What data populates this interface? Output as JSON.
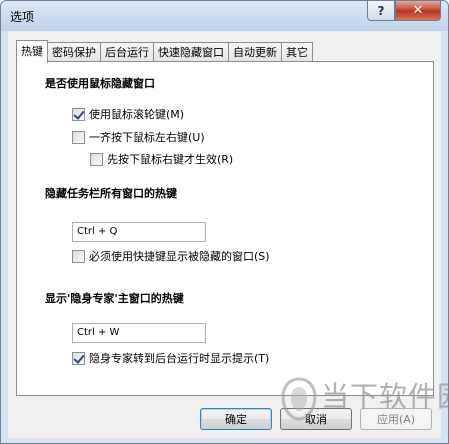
{
  "window": {
    "title": "选项",
    "help_label": "?",
    "close_label": "✕"
  },
  "tabs": [
    {
      "label": "热键",
      "active": true
    },
    {
      "label": "密码保护",
      "active": false
    },
    {
      "label": "后台运行",
      "active": false
    },
    {
      "label": "快速隐藏窗口",
      "active": false
    },
    {
      "label": "自动更新",
      "active": false
    },
    {
      "label": "其它",
      "active": false
    }
  ],
  "panel": {
    "section1": {
      "title": "是否使用鼠标隐藏窗口",
      "options": [
        {
          "label": "使用鼠标滚轮键(M)",
          "checked": true
        },
        {
          "label": "一齐按下鼠标左右键(U)",
          "checked": false
        },
        {
          "label": "先按下鼠标右键才生效(R)",
          "checked": false
        }
      ]
    },
    "section2": {
      "title": "隐藏任务栏所有窗口的热键",
      "hotkey": "Ctrl + Q",
      "option": {
        "label": "必须使用快捷键显示被隐藏的窗口(S)",
        "checked": false
      }
    },
    "section3": {
      "title": "显示'隐身专家'主窗口的热键",
      "hotkey": "Ctrl + W",
      "option": {
        "label": "隐身专家转到后台运行时显示提示(T)",
        "checked": true
      }
    }
  },
  "buttons": {
    "ok": "确定",
    "cancel": "取消",
    "apply": "应用(A)"
  },
  "watermark": {
    "text": "当下软件园"
  }
}
